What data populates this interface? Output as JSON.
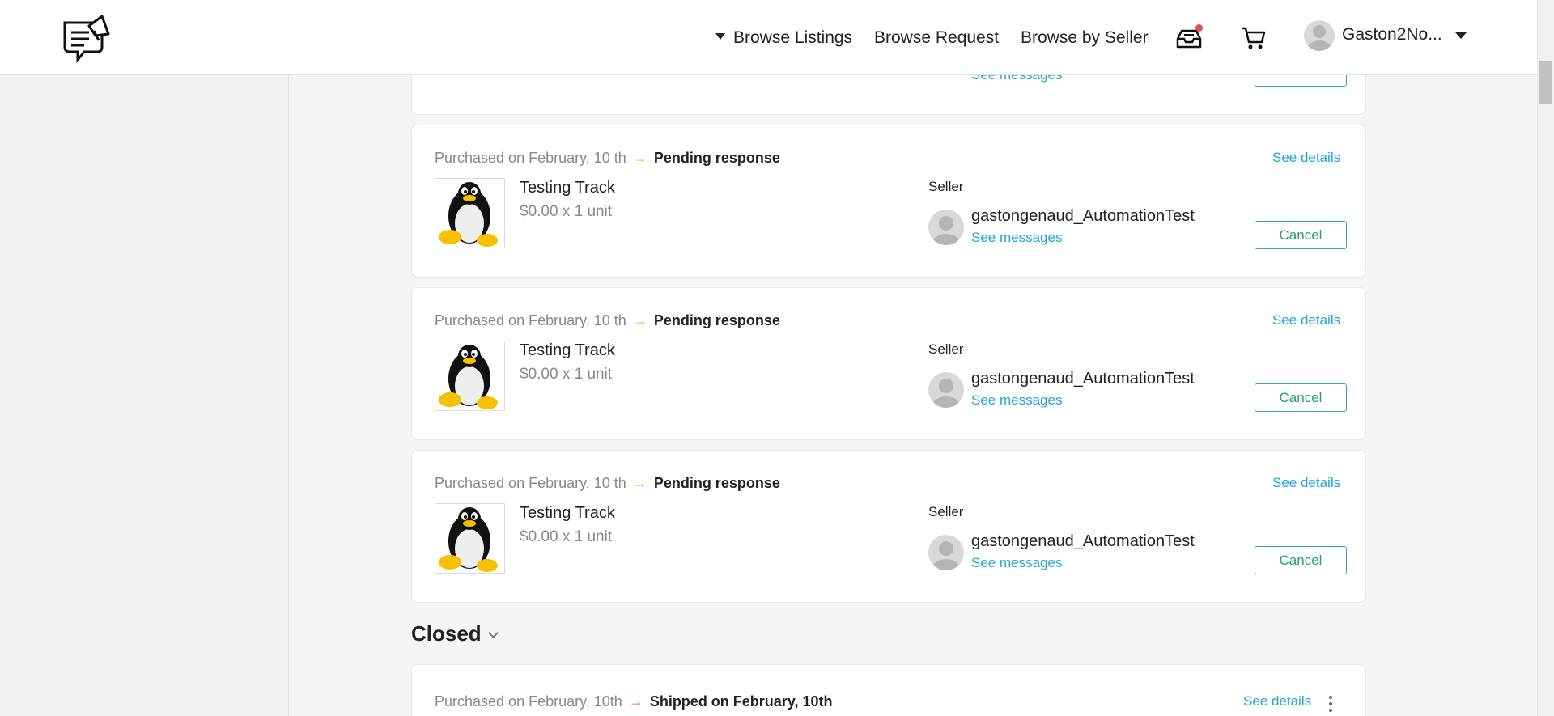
{
  "nav": {
    "browse_listings": "Browse Listings",
    "browse_request": "Browse Request",
    "browse_by_seller": "Browse by Seller",
    "user_name": "Gaston2No..."
  },
  "orders": [
    {
      "date_text": "Purchased on February, 10 th",
      "status": "Pending response",
      "see_details": "See details",
      "product_name": "Testing Track",
      "price_text": "$0.00 x 1 unit",
      "seller_label": "Seller",
      "seller_name": "gastongenaud_AutomationTest",
      "see_messages": "See messages",
      "cancel_label": "Cancel"
    },
    {
      "date_text": "Purchased on February, 10 th",
      "status": "Pending response",
      "see_details": "See details",
      "product_name": "Testing Track",
      "price_text": "$0.00 x 1 unit",
      "seller_label": "Seller",
      "seller_name": "gastongenaud_AutomationTest",
      "see_messages": "See messages",
      "cancel_label": "Cancel"
    },
    {
      "date_text": "Purchased on February, 10 th",
      "status": "Pending response",
      "see_details": "See details",
      "product_name": "Testing Track",
      "price_text": "$0.00 x 1 unit",
      "seller_label": "Seller",
      "seller_name": "gastongenaud_AutomationTest",
      "see_messages": "See messages",
      "cancel_label": "Cancel"
    }
  ],
  "partial_order": {
    "see_messages": "See messages"
  },
  "closed": {
    "title": "Closed",
    "order": {
      "date_text": "Purchased on February, 10th",
      "status": "Shipped on February, 10th",
      "see_details": "See details"
    }
  },
  "colors": {
    "link": "#1ea7d8",
    "cancel": "#2ab29a",
    "pending_arrow": "#f0a020",
    "shipped_arrow": "#e84c4c",
    "notification": "#e84c4c"
  }
}
